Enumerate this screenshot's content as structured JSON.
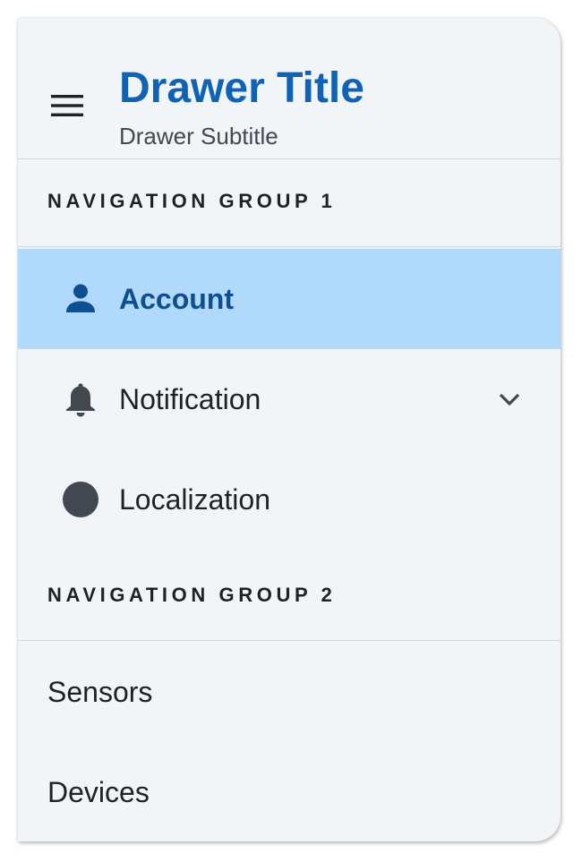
{
  "header": {
    "title": "Drawer Title",
    "subtitle": "Drawer Subtitle"
  },
  "groups": [
    {
      "title": "NAVIGATION GROUP 1",
      "items": [
        {
          "label": "Account",
          "icon": "person-icon",
          "active": true
        },
        {
          "label": "Notification",
          "icon": "bell-icon",
          "expandable": true,
          "expand_icon": "chevron-down-icon"
        },
        {
          "label": "Localization",
          "icon": "circle-icon"
        }
      ]
    },
    {
      "title": "NAVIGATION GROUP 2",
      "items": [
        {
          "label": "Sensors"
        },
        {
          "label": "Devices"
        }
      ]
    }
  ],
  "colors": {
    "brand": "#0f62b4",
    "active_background": "#b0d9fb",
    "active_text": "#0d4f91",
    "drawer_background": "#f2f5f8",
    "icon": "#424850"
  }
}
